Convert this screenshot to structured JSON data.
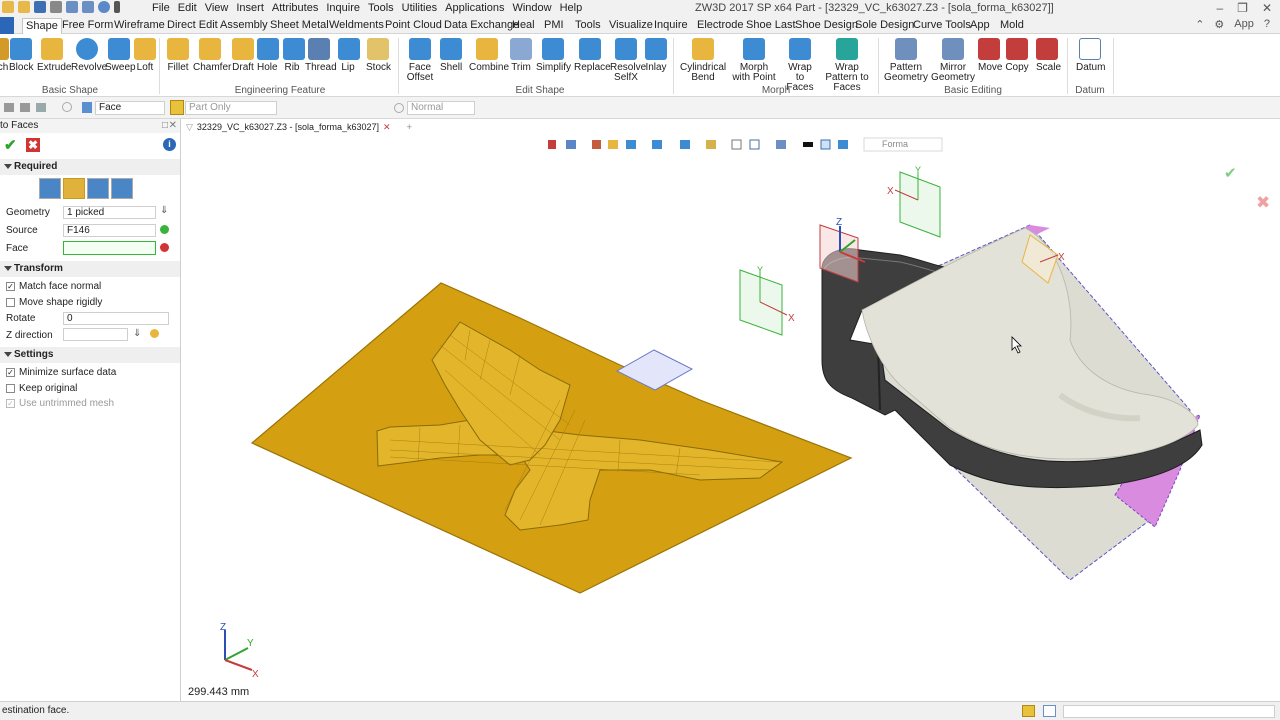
{
  "title_bar": {
    "menu": [
      "File",
      "Edit",
      "View",
      "Insert",
      "Attributes",
      "Inquire",
      "Tools",
      "Utilities",
      "Applications",
      "Window",
      "Help"
    ],
    "window_title": "ZW3D 2017 SP x64      Part - [32329_VC_k63027.Z3 - [sola_forma_k63027]]"
  },
  "ribbon_tabs": [
    "Shape",
    "Free Form",
    "Wireframe",
    "Direct Edit",
    "Assembly",
    "Sheet Metal",
    "Weldments",
    "Point Cloud",
    "Data Exchange",
    "Heal",
    "PMI",
    "Tools",
    "Visualize",
    "Inquire",
    "Electrode",
    "Shoe Last",
    "Shoe Design",
    "Sole Design",
    "Curve Tools",
    "App",
    "Mold"
  ],
  "ribbon_tab_right": "App",
  "ribbon": {
    "basic_shape": [
      "ch",
      "Block",
      "Extrude",
      "Revolve",
      "Sweep",
      "Loft"
    ],
    "basic_shape_label": "Basic Shape",
    "engineering": [
      "Fillet",
      "Chamfer",
      "Draft",
      "Hole",
      "Rib",
      "Thread",
      "Lip",
      "Stock"
    ],
    "engineering_label": "Engineering Feature",
    "edit_shape": [
      "Face Offset",
      "Shell",
      "Combine",
      "Trim",
      "Simplify",
      "Replace",
      "Resolve SelfX",
      "Inlay"
    ],
    "edit_shape_label": "Edit Shape",
    "morph": [
      "Cylindrical Bend",
      "Morph with Point",
      "Wrap to Faces",
      "Wrap Pattern to Faces"
    ],
    "morph_label": "Morph",
    "basic_editing": [
      "Pattern Geometry",
      "Mirror Geometry",
      "Move",
      "Copy",
      "Scale"
    ],
    "basic_editing_label": "Basic Editing",
    "datum": [
      "Datum"
    ],
    "datum_label": "Datum"
  },
  "toolbar2": {
    "filter": "Face",
    "scope": "Part Only",
    "display": "Normal"
  },
  "panel": {
    "title": "to Faces",
    "required": "Required",
    "geometry_label": "Geometry",
    "geometry_value": "1 picked",
    "source_label": "Source",
    "source_value": "F146",
    "face_label": "Face",
    "face_value": "",
    "transform": "Transform",
    "match_face_normal": "Match face normal",
    "move_rigidly": "Move shape rigidly",
    "rotate_label": "Rotate",
    "rotate_value": "0",
    "z_dir_label": "Z direction",
    "settings": "Settings",
    "minimize": "Minimize surface data",
    "keep_original": "Keep original",
    "untrimmed": "Use untrimmed mesh"
  },
  "document_tab": "32329_VC_k63027.Z3 - [sola_forma_k63027]",
  "viewport": {
    "measure": "299.443 mm",
    "render_mode": "Forma"
  },
  "status": {
    "prompt": "estination face."
  },
  "colors": {
    "accent": "#2b67b6",
    "sole_orange": "#d4a012",
    "shoe_grey": "#dcdcd2"
  }
}
